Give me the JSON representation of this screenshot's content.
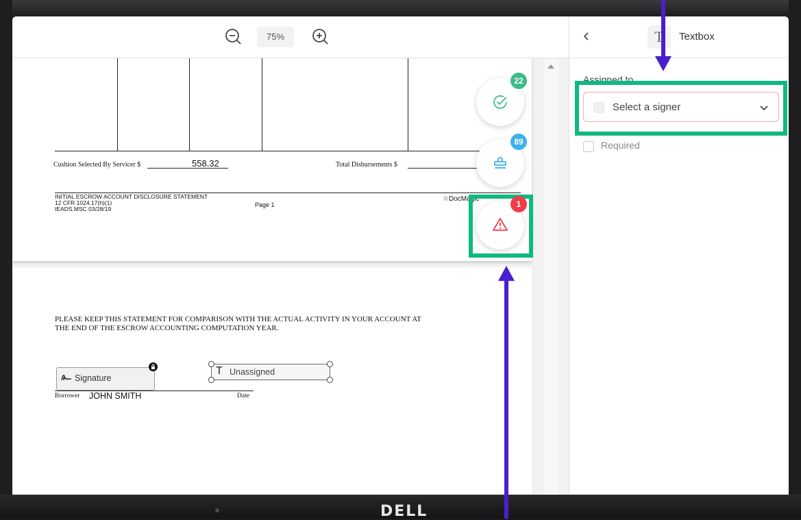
{
  "toolbar": {
    "zoom_out_icon": "zoom-out-icon",
    "zoom_level": "75%",
    "zoom_in_icon": "zoom-in-icon"
  },
  "document": {
    "cushion_label": "Cushion Selected By Servicer $",
    "cushion_value": "558.32",
    "total_disbursements_label": "Total Disbursements $",
    "footer_title": "INITIAL ESCROW ACCOUNT DISCLOSURE STATEMENT",
    "footer_cfr": "12 CFR 1024.17(h)(1)",
    "footer_code": "IEADS.MSC  03/28/19",
    "page_label": "Page 1",
    "brand": "DocMagic",
    "notice_line1": "PLEASE KEEP THIS STATEMENT FOR COMPARISON WITH  THE ACTUAL ACTIVITY IN YOUR ACCOUNT AT",
    "notice_line2": "THE END OF THE ESCROW ACCOUNTING COMPUTATION YEAR.",
    "signature_field_label": "Signature",
    "textbox_field_label": "Unassigned",
    "borrower_label": "Borrower",
    "borrower_name": "JOHN SMITH",
    "date_label": "Date"
  },
  "fabs": [
    {
      "name": "completed",
      "icon": "check-circle-icon",
      "count": "22",
      "color": "#3dbb8c"
    },
    {
      "name": "stamp",
      "icon": "stamp-icon",
      "count": "89",
      "color": "#3db0ef"
    },
    {
      "name": "warning",
      "icon": "warning-triangle-icon",
      "count": "1",
      "color": "#ef3e4a"
    }
  ],
  "panel": {
    "back_icon": "chevron-left-icon",
    "field_type_icon": "text-t-icon",
    "title": "Textbox",
    "assigned_to_label": "Assigned to",
    "signer_placeholder": "Select a signer",
    "required_label": "Required"
  },
  "device": {
    "brand": "DELL"
  },
  "colors": {
    "highlight": "#10b981",
    "arrow": "#4a1fcf",
    "warning": "#ef3e4a"
  }
}
